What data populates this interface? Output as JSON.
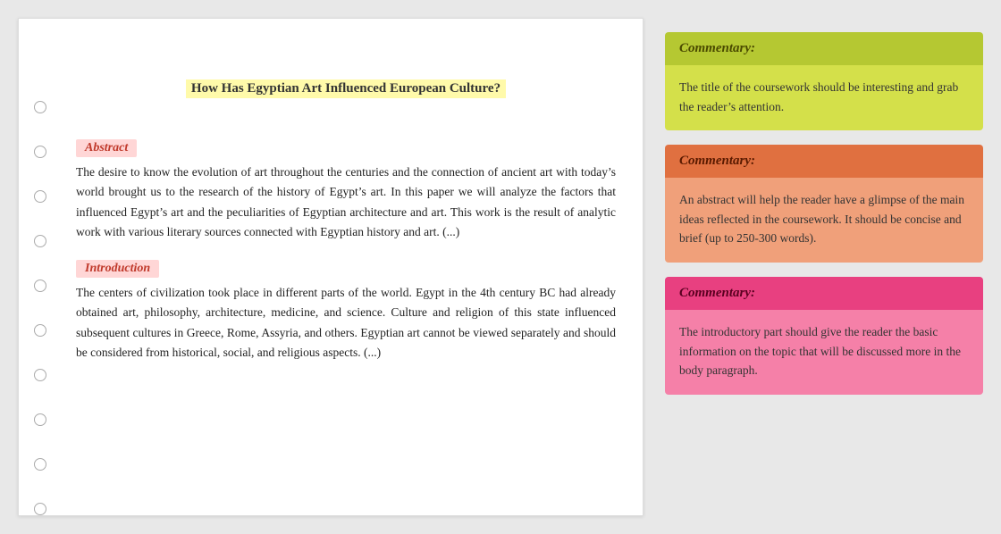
{
  "document": {
    "title": "How Has Egyptian Art Influenced European Culture?",
    "abstract_label": "Abstract",
    "abstract_text": "The desire to know the evolution of art throughout the centuries and the connection of ancient art with today’s world brought us to the research of the history of Egypt’s art. In this paper we will analyze the factors that influenced Egypt’s art and the peculiarities of Egyptian architecture and art. This work is the result of analytic work with various literary sources connected with Egyptian history and art. (...)",
    "introduction_label": "Introduction",
    "introduction_text": "The centers of civilization took place in different parts of the world. Egypt in the 4th century BC had already obtained art, philosophy, architecture, medicine, and science. Culture and religion of this state influenced subsequent cultures in Greece, Rome, Assyria, and others. Egyptian art cannot be viewed separately and should be considered from historical, social, and religious aspects. (...)"
  },
  "commentaries": [
    {
      "id": "card-1",
      "header": "Commentary:",
      "body": "The title of the coursework should be interesting and grab the reader’s attention."
    },
    {
      "id": "card-2",
      "header": "Commentary:",
      "body": "An abstract will help the reader have a glimpse of the main ideas reflected in the coursework. It should be concise and brief (up to 250-300 words)."
    },
    {
      "id": "card-3",
      "header": "Commentary:",
      "body": "The introductory part should give the reader the basic information on the topic that will be discussed more in the body paragraph."
    }
  ],
  "bullets": [
    1,
    2,
    3,
    4,
    5,
    6,
    7,
    8,
    9,
    10
  ]
}
